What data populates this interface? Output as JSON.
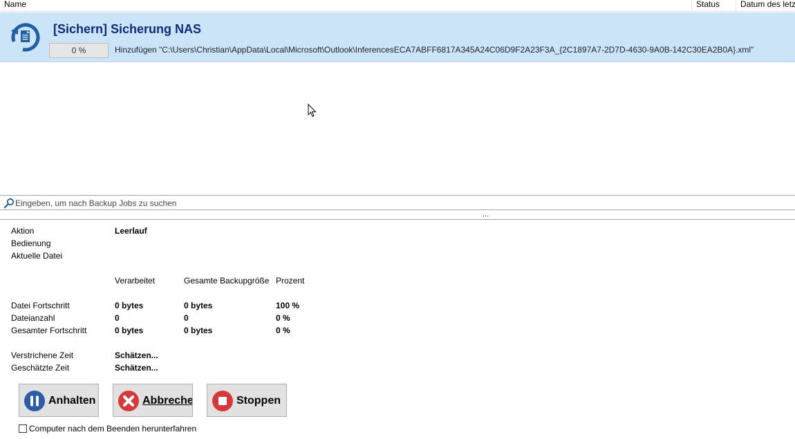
{
  "columns": {
    "name": "Name",
    "status": "Status",
    "date": "Datum des letz"
  },
  "job": {
    "icon": "backup-restore-icon",
    "title": "[Sichern] Sicherung NAS",
    "progress_text": "0 %",
    "progress_fraction": 0,
    "current_file": "Hinzufügen \"C:\\Users\\Christian\\AppData\\Local\\Microsoft\\Outlook\\InferencesECA7ABFF6817A345A24C06D9F2A23F3A_{2C1897A7-2D7D-4630-9A0B-142C30EA2B0A}.xml\""
  },
  "search": {
    "placeholder": "Eingeben, um nach Backup Jobs zu suchen"
  },
  "splitter": {
    "grip": "..."
  },
  "details": {
    "action_label": "Aktion",
    "action_value": "Leerlauf",
    "operation_label": "Bedienung",
    "current_file_label": "Aktuelle Datei",
    "headers": {
      "processed": "Verarbeitet",
      "total_size": "Gesamte Backupgröße",
      "percent": "Prozent"
    },
    "rows": [
      {
        "label": "Datei Fortschritt",
        "processed": "0 bytes",
        "total": "0 bytes",
        "percent": "100 %"
      },
      {
        "label": "Dateianzahl",
        "processed": "0",
        "total": "0",
        "percent": "0 %"
      },
      {
        "label": "Gesamter Fortschritt",
        "processed": "0 bytes",
        "total": "0 bytes",
        "percent": "0 %"
      }
    ],
    "elapsed_label": "Verstrichene Zeit",
    "elapsed_value": "Schätzen...",
    "estimated_label": "Geschätzte Zeit",
    "estimated_value": "Schätzen..."
  },
  "buttons": {
    "pause": "Anhalten",
    "cancel": "Abbrechen",
    "stop": "Stoppen"
  },
  "shutdown": {
    "label": "Computer nach dem Beenden herunterfahren",
    "checked": false
  },
  "colors": {
    "selection": "#cce4f7",
    "title": "#0b2b85",
    "pause_icon": "#2a5ca8",
    "cancel_icon": "#d9383b",
    "stop_icon": "#d9383b"
  }
}
